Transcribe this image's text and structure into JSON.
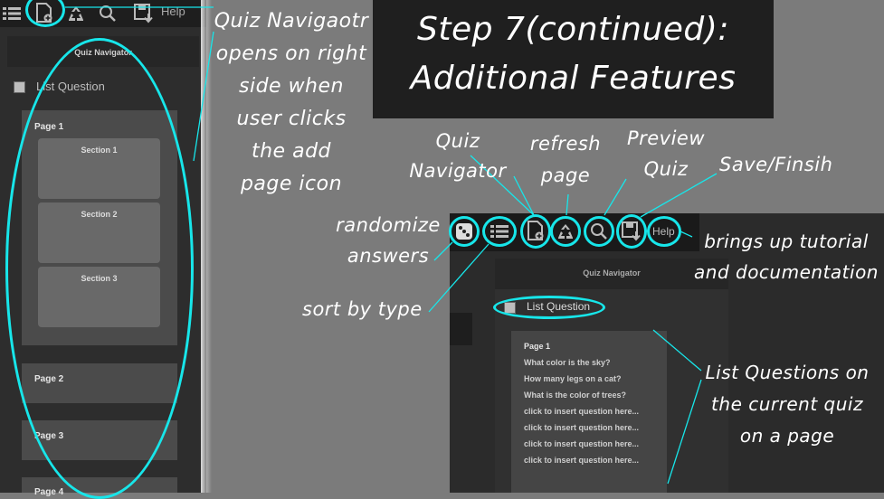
{
  "left": {
    "toolbar": {
      "help_label": "Help"
    },
    "nav_title": "Quiz Navigator",
    "list_question_label": "List Question",
    "pages": [
      {
        "label": "Page 1",
        "sections": [
          "Section 1",
          "Section 2",
          "Section 3"
        ]
      },
      {
        "label": "Page 2"
      },
      {
        "label": "Page 3"
      },
      {
        "label": "Page 4"
      }
    ]
  },
  "title": {
    "line1": "Step 7(continued):",
    "line2": "Additional Features"
  },
  "annotations": {
    "nav_opens": [
      "Quiz Navigaotr",
      "opens on right",
      "side when",
      "user clicks",
      "the add",
      "page icon"
    ],
    "quiz_navigator": [
      "Quiz",
      "Navigator"
    ],
    "refresh": [
      "refresh",
      "page"
    ],
    "preview": [
      "Preview",
      "Quiz"
    ],
    "save": "Save/Finsih",
    "randomize": [
      "randomize",
      "answers"
    ],
    "sort": "sort by type",
    "help": [
      "brings up tutorial",
      "and documentation"
    ],
    "list_questions": [
      "List Questions on",
      "the current quiz",
      "on a page"
    ]
  },
  "right": {
    "toolbar": {
      "help_label": "Help"
    },
    "nav_title": "Quiz Navigator",
    "list_question_label": "List Question",
    "page_label": "Page 1",
    "questions": [
      "What color is the sky?",
      "How many legs on a cat?",
      "What is the color of trees?",
      "click to insert question here...",
      "click to insert question here...",
      "click to insert question here...",
      "click to insert question here..."
    ]
  },
  "colors": {
    "accent": "#17e6ea",
    "background": "#7b7b7b",
    "panel": "#2a2a2a"
  }
}
